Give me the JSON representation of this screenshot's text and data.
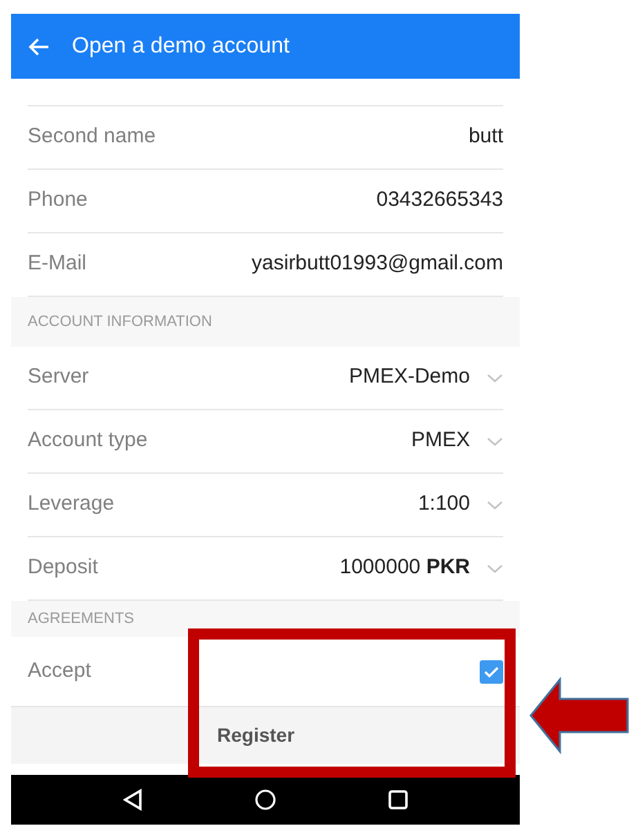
{
  "header": {
    "title": "Open a demo account"
  },
  "personal_rows": [
    {
      "label": "Second name",
      "value": "butt"
    },
    {
      "label": "Phone",
      "value": "03432665343"
    },
    {
      "label": "E-Mail",
      "value": "yasirbutt01993@gmail.com"
    }
  ],
  "account_section": {
    "title": "ACCOUNT INFORMATION"
  },
  "account_rows": [
    {
      "label": "Server",
      "value": "PMEX-Demo"
    },
    {
      "label": "Account type",
      "value": "PMEX"
    },
    {
      "label": "Leverage",
      "value": "1:100"
    },
    {
      "label": "Deposit",
      "value": "1000000 **PKR**"
    }
  ],
  "agreements_section": {
    "title": "AGREEMENTS"
  },
  "accept": {
    "label": "Accept",
    "checked": true
  },
  "register_button": {
    "label": "Register"
  }
}
